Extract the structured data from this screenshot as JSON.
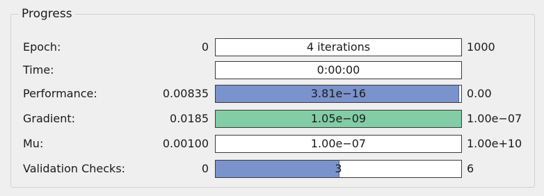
{
  "colors": {
    "performance_fill": "#7b93cc",
    "gradient_fill": "#82cca6",
    "validation_fill": "#7b93cc",
    "bar_background": "#ffffff"
  },
  "progress": {
    "title": "Progress",
    "rows": [
      {
        "label": "Epoch:",
        "min": "0",
        "value_text": "4 iterations",
        "max": "1000",
        "fill_fraction": 0,
        "color_key": ""
      },
      {
        "label": "Time:",
        "min": "",
        "value_text": "0:00:00",
        "max": "",
        "fill_fraction": 0,
        "color_key": ""
      },
      {
        "label": "Performance:",
        "min": "0.00835",
        "value_text": "3.81e−16",
        "max": "0.00",
        "fill_fraction": 0.99,
        "color_key": "performance_fill"
      },
      {
        "label": "Gradient:",
        "min": "0.0185",
        "value_text": "1.05e−09",
        "max": "1.00e−07",
        "fill_fraction": 1.0,
        "color_key": "gradient_fill"
      },
      {
        "label": "Mu:",
        "min": "0.00100",
        "value_text": "1.00e−07",
        "max": "1.00e+10",
        "fill_fraction": 0,
        "color_key": ""
      },
      {
        "label": "Validation Checks:",
        "min": "0",
        "value_text": "3",
        "max": "6",
        "fill_fraction": 0.5,
        "color_key": "validation_fill"
      }
    ]
  }
}
